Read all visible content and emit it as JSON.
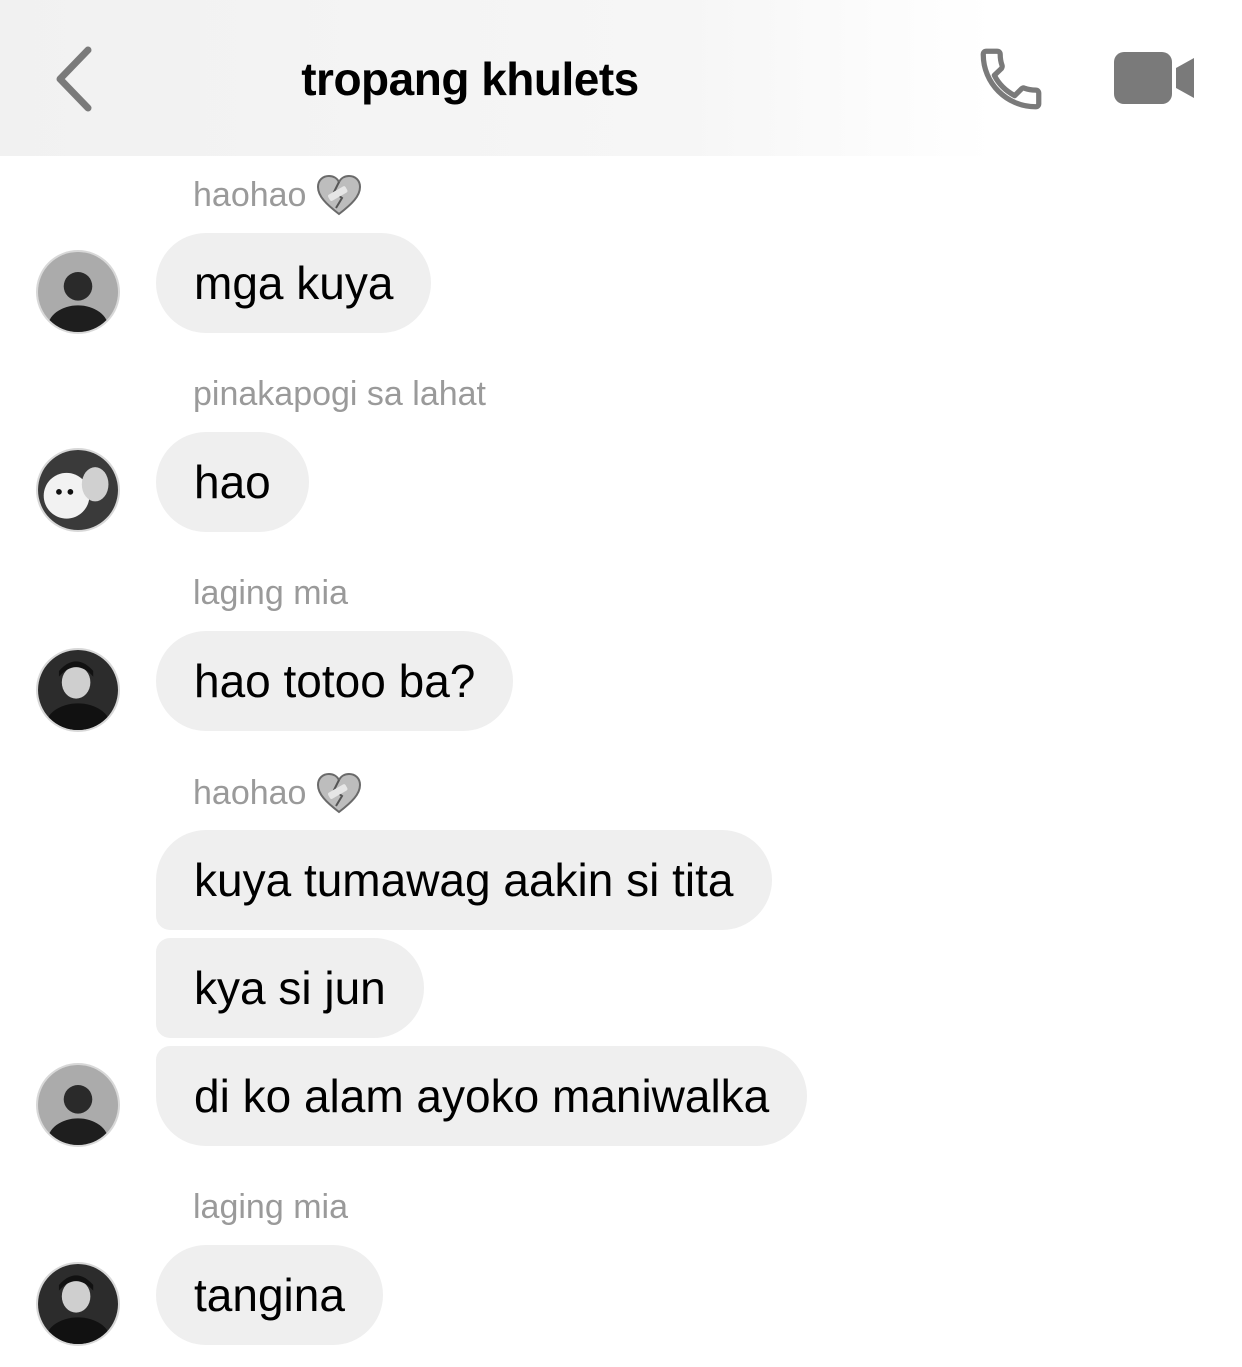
{
  "header": {
    "title": "tropang khulets",
    "back_icon": "chevron-left-icon",
    "call_icon": "phone-icon",
    "video_icon": "video-camera-icon"
  },
  "messages": [
    {
      "sender": "haohao",
      "sender_emoji": "mending-heart-emoji",
      "texts": [
        "mga kuya"
      ]
    },
    {
      "sender": "pinakapogi sa lahat",
      "texts": [
        "hao"
      ]
    },
    {
      "sender": "laging mia",
      "texts": [
        "hao totoo ba?"
      ]
    },
    {
      "sender": "haohao",
      "sender_emoji": "mending-heart-emoji",
      "texts": [
        "kuya tumawag aakin si tita",
        "kya si jun",
        "di ko alam ayoko maniwalka"
      ]
    },
    {
      "sender": "laging mia",
      "texts": [
        "tangina"
      ]
    }
  ],
  "colors": {
    "bubble": "#efefef",
    "sender_label": "#9a9a9a",
    "icon": "#7a7a7a"
  }
}
